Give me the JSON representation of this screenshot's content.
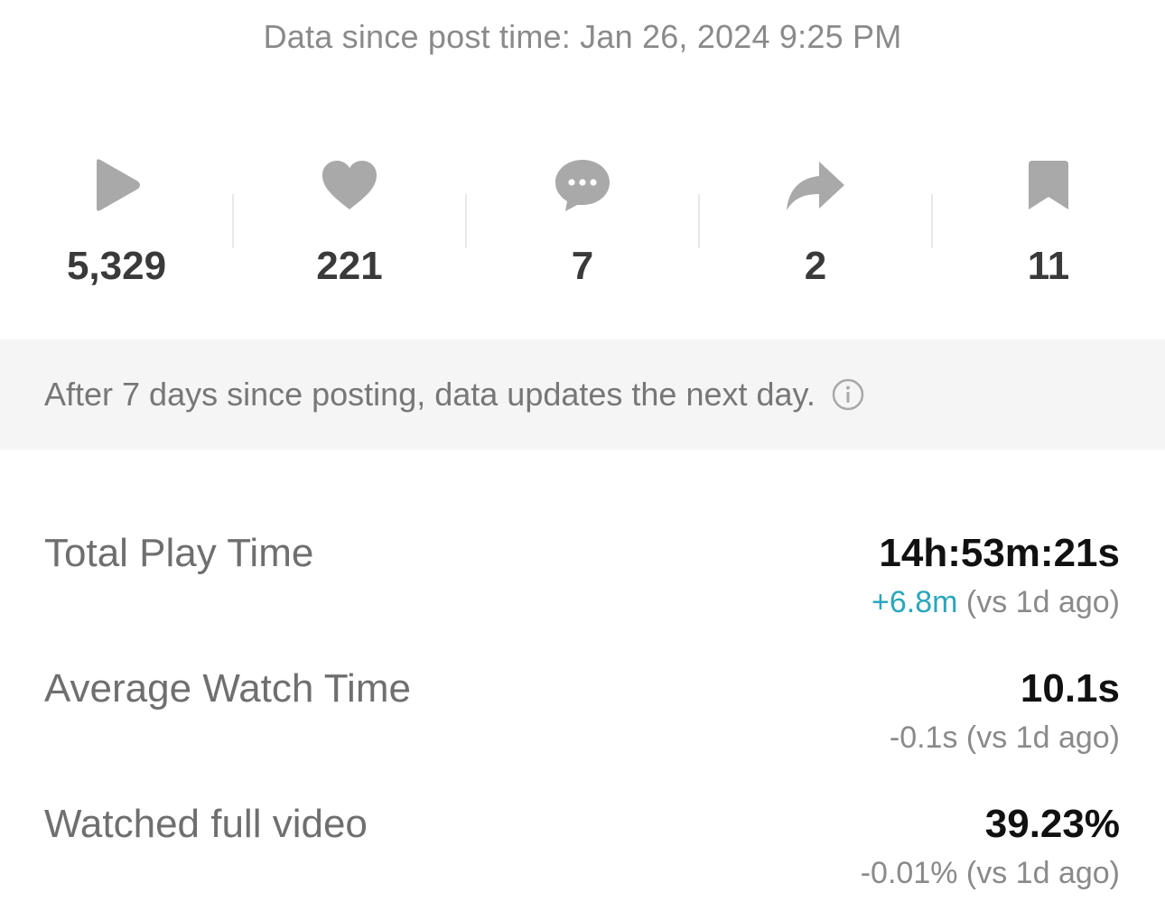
{
  "header": {
    "data_since": "Data since post time: Jan 26, 2024 9:25 PM"
  },
  "stats": [
    {
      "icon": "play-icon",
      "count": "5,329"
    },
    {
      "icon": "heart-icon",
      "count": "221"
    },
    {
      "icon": "comment-icon",
      "count": "7"
    },
    {
      "icon": "share-icon",
      "count": "2"
    },
    {
      "icon": "bookmark-icon",
      "count": "11"
    }
  ],
  "notice": {
    "text": "After 7 days since posting, data updates the next day."
  },
  "metrics": {
    "total_play_time": {
      "label": "Total Play Time",
      "value": "14h:53m:21s",
      "delta_change": "+6.8m",
      "delta_suffix": " (vs 1d ago)"
    },
    "average_watch_time": {
      "label": "Average Watch Time",
      "value": "10.1s",
      "delta": "-0.1s (vs 1d ago)"
    },
    "watched_full_video": {
      "label": "Watched full video",
      "value": "39.23%",
      "delta": "-0.01% (vs 1d ago)"
    }
  },
  "colors": {
    "icon_gray": "#a9a9a9",
    "positive_delta": "#2aa7bd",
    "notice_background": "#f5f5f5"
  }
}
